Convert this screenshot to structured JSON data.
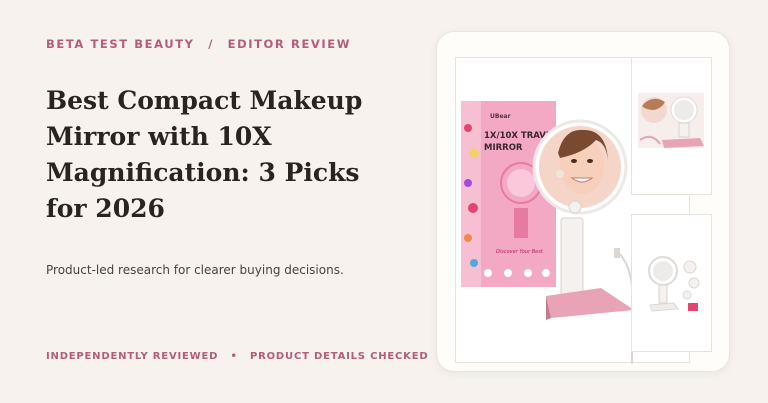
{
  "header": {
    "brand": "BETA TEST BEAUTY",
    "separator": "/",
    "section": "EDITOR REVIEW"
  },
  "article": {
    "title": "Best Compact Makeup Mirror with 10X Magnification: 3 Picks for 2026",
    "subtitle": "Product-led research for clearer buying decisions."
  },
  "footer": {
    "left": "INDEPENDENTLY REVIEWED",
    "bullet": "•",
    "right": "PRODUCT DETAILS CHECKED"
  },
  "product_image": {
    "box_brand": "UBear",
    "box_title_line1": "1X/10X TRAVEL",
    "box_title_line2": "MIRROR",
    "box_script": "Discover Your Best",
    "mirror_brand": "UBear"
  },
  "colors": {
    "accent": "#b35d7c",
    "background": "#f7f2ee",
    "title": "#2a2420",
    "box_pink": "#f3a9c3",
    "mirror_pink": "#e8a3b6"
  }
}
